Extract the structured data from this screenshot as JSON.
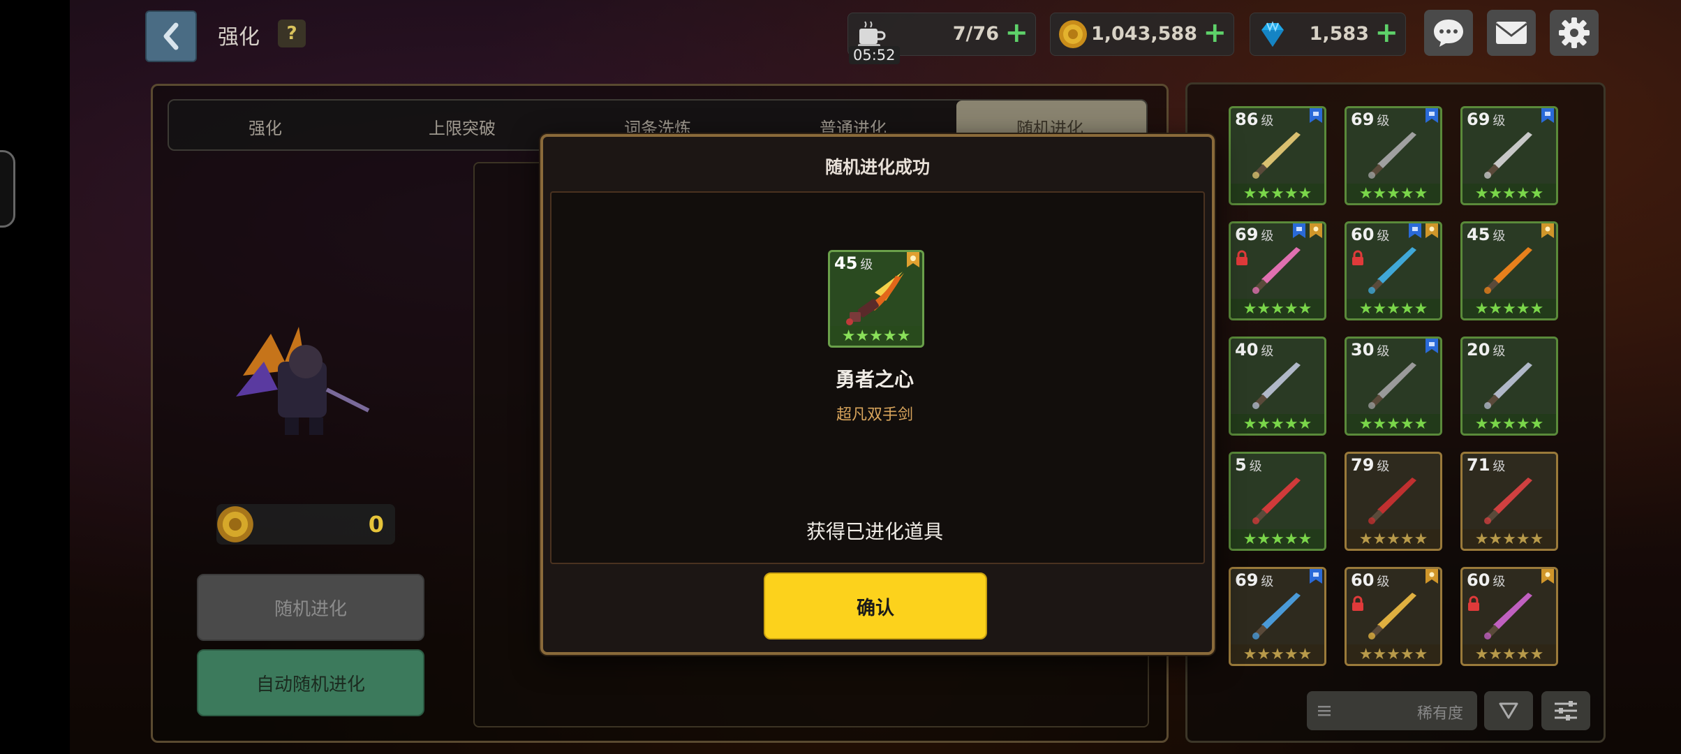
{
  "header": {
    "title": "强化",
    "help_label": "?",
    "stamina": {
      "value": "7/76",
      "timer": "05:52"
    },
    "gold": {
      "value": "1,043,588"
    },
    "gems": {
      "value": "1,583"
    }
  },
  "tabs": [
    {
      "label": "强化"
    },
    {
      "label": "上限突破"
    },
    {
      "label": "词条洗炼"
    },
    {
      "label": "普通进化"
    },
    {
      "label": "随机进化",
      "active": true
    }
  ],
  "left": {
    "cost": "0",
    "random_button": "随机进化",
    "auto_button": "自动随机进化"
  },
  "inventory": {
    "unit": "级",
    "items": [
      {
        "level": "86",
        "stars": 5,
        "frame": "green",
        "art": "shield-icon"
      },
      {
        "level": "69",
        "stars": 5,
        "frame": "green",
        "art": "drill-icon"
      },
      {
        "level": "69",
        "stars": 5,
        "frame": "green",
        "art": "crossbow-icon"
      },
      {
        "level": "69",
        "stars": 5,
        "frame": "green",
        "art": "wing-staff-icon",
        "locked": true
      },
      {
        "level": "60",
        "stars": 5,
        "frame": "green",
        "art": "blue-gun-icon",
        "locked": true
      },
      {
        "level": "45",
        "stars": 5,
        "frame": "green",
        "art": "flame-sword-icon"
      },
      {
        "level": "40",
        "stars": 5,
        "frame": "green",
        "art": "sword-icon"
      },
      {
        "level": "30",
        "stars": 5,
        "frame": "green",
        "art": "armor-icon"
      },
      {
        "level": "20",
        "stars": 5,
        "frame": "green",
        "art": "sword-icon"
      },
      {
        "level": "5",
        "stars": 5,
        "frame": "green",
        "art": "ring-icon"
      },
      {
        "level": "79",
        "stars": 5,
        "frame": "gold",
        "art": "red-armor-icon"
      },
      {
        "level": "71",
        "stars": 5,
        "frame": "gold",
        "art": "rose-icon"
      },
      {
        "level": "69",
        "stars": 5,
        "frame": "gold",
        "art": "bow-icon"
      },
      {
        "level": "60",
        "stars": 5,
        "frame": "gold",
        "art": "gold-sword-icon",
        "locked": true
      },
      {
        "level": "60",
        "stars": 5,
        "frame": "gold",
        "art": "blaster-icon",
        "locked": true
      }
    ],
    "sort_label": "稀有度"
  },
  "modal": {
    "title": "随机进化成功",
    "item_level": "45",
    "item_level_unit": "级",
    "item_name": "勇者之心",
    "item_type": "超凡双手剑",
    "result_text": "获得已进化道具",
    "confirm_label": "确认"
  },
  "colors": {
    "accent_yellow": "#fcd21c",
    "gold_text": "#e6c43a",
    "star_green": "#7ad64a",
    "plus_green": "#5ed16a",
    "item_type_orange": "#d9a55c"
  }
}
